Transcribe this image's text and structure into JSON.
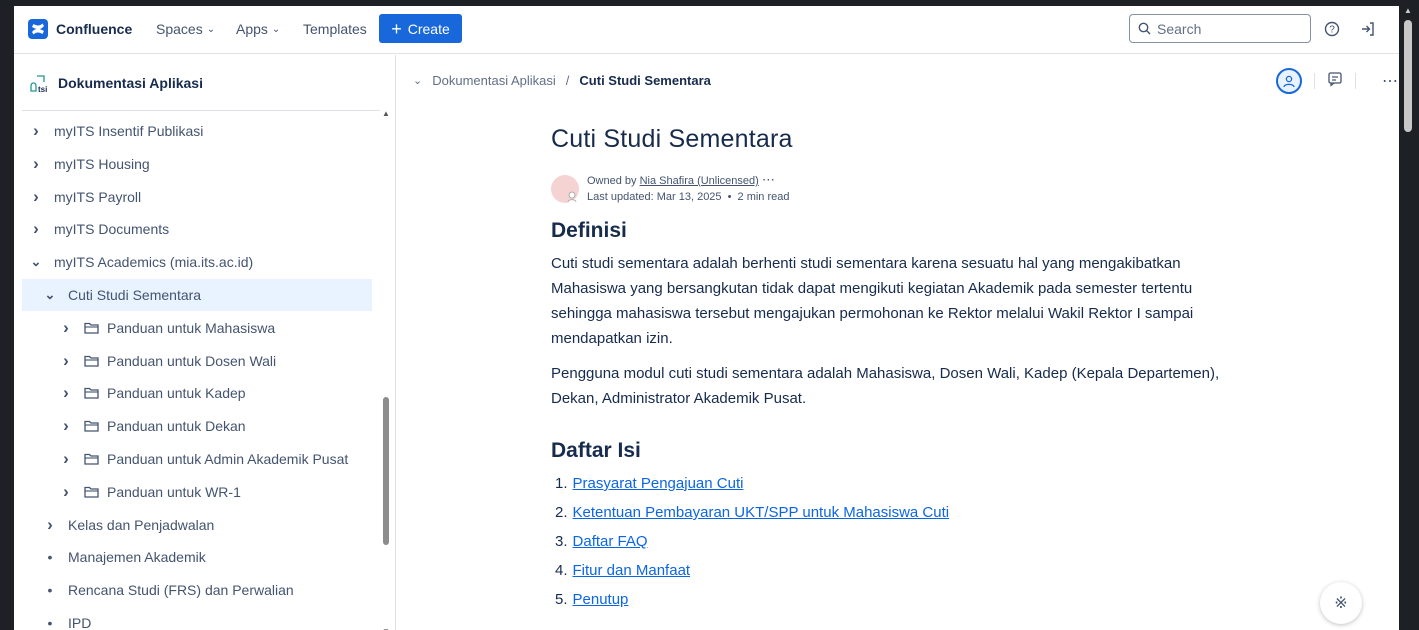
{
  "topnav": {
    "brand": "Confluence",
    "spaces": "Spaces",
    "apps": "Apps",
    "templates": "Templates",
    "create": "Create",
    "search_placeholder": "Search"
  },
  "sidebar": {
    "space_title": "Dokumentasi Aplikasi",
    "items": [
      {
        "label": "myITS Insentif Publikasi",
        "kind": "arrow"
      },
      {
        "label": "myITS Housing",
        "kind": "arrow"
      },
      {
        "label": "myITS Payroll",
        "kind": "arrow"
      },
      {
        "label": "myITS Documents",
        "kind": "arrow"
      },
      {
        "label": "myITS Academics (mia.its.ac.id)",
        "kind": "expanded"
      },
      {
        "label": "Cuti Studi Sementara",
        "kind": "expanded"
      },
      {
        "label": "Panduan untuk Mahasiswa",
        "kind": "folder"
      },
      {
        "label": "Panduan untuk Dosen Wali",
        "kind": "folder"
      },
      {
        "label": "Panduan untuk Kadep",
        "kind": "folder"
      },
      {
        "label": "Panduan untuk Dekan",
        "kind": "folder"
      },
      {
        "label": "Panduan untuk Admin Akademik Pusat",
        "kind": "folder"
      },
      {
        "label": "Panduan untuk WR-1",
        "kind": "folder"
      },
      {
        "label": "Kelas dan Penjadwalan",
        "kind": "arrow"
      },
      {
        "label": "Manajemen Akademik",
        "kind": "bullet"
      },
      {
        "label": "Rencana Studi (FRS) dan Perwalian",
        "kind": "bullet"
      },
      {
        "label": "IPD",
        "kind": "bullet"
      }
    ]
  },
  "breadcrumb": {
    "parent": "Dokumentasi Aplikasi",
    "separator": "/",
    "current": "Cuti Studi Sementara"
  },
  "page": {
    "title": "Cuti Studi Sementara",
    "owned_by": "Owned by",
    "owner": "Nia Shafira (Unlicensed)",
    "updated": "Last updated: Mar 13, 2025",
    "dot": "•",
    "read_time": "2 min read",
    "h_definisi": "Definisi",
    "p1": "Cuti studi sementara adalah berhenti studi sementara karena sesuatu hal yang mengakibatkan Mahasiswa yang bersangkutan tidak dapat mengikuti kegiatan Akademik pada semester tertentu sehingga mahasiswa tersebut mengajukan permohonan ke Rektor melalui Wakil Rektor I sampai mendapatkan izin.",
    "p2": "Pengguna modul cuti studi sementara adalah Mahasiswa, Dosen Wali, Kadep (Kepala Departemen), Dekan, Administrator Akademik Pusat.",
    "h_daftar": "Daftar Isi",
    "toc": [
      {
        "num": "1.",
        "label": "Prasyarat Pengajuan Cuti"
      },
      {
        "num": "2.",
        "label": "Ketentuan Pembayaran UKT/SPP untuk Mahasiswa Cuti"
      },
      {
        "num": "3.",
        "label": "Daftar FAQ"
      },
      {
        "num": "4.",
        "label": "Fitur dan Manfaat"
      },
      {
        "num": "5.",
        "label": "Penutup"
      }
    ]
  },
  "colors": {
    "brand_blue": "#1868db",
    "link": "#0c66e4",
    "selected_bg": "#e9f2ff"
  }
}
